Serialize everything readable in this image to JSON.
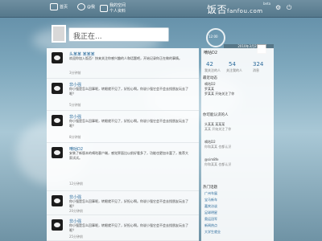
{
  "nav": {
    "home": "首页",
    "at": "@我",
    "my_space": "我的空间",
    "profile": "个人资料"
  },
  "logo": {
    "main": "饭否",
    "domain": "fanfou.com",
    "beta": "beta"
  },
  "composer": {
    "placeholder": "我正在..."
  },
  "clock": {
    "text": "12:00",
    "date": "2010年3月2日"
  },
  "sidebar": {
    "user_name": "嘀咕D2",
    "stats": [
      {
        "label": "我关注的人",
        "value": "42"
      },
      {
        "label": "关注我的人",
        "value": "54"
      },
      {
        "label": "消息",
        "value": "324"
      }
    ],
    "latest_label": "最近动态",
    "latest_items": [
      "嘀咕D2",
      "罗某某",
      "罗某某 开始关注了你"
    ],
    "who_to_follow_label": "你可能认识的人",
    "people": [
      {
        "name": "头某某 某某某",
        "note": "某某 开始关注了你"
      },
      {
        "name": "嘀咕D2",
        "note": "你和某某 也都认识"
      },
      {
        "name": "@sim8fe",
        "note": "你和某某 也都认识"
      }
    ],
    "hot_topics_label": "热门话题",
    "topics": [
      "广州车展",
      "宝马新车",
      "嘉宾访谈",
      "足球明星",
      "奥运冠军",
      "新闻热点",
      "大学生就业"
    ]
  },
  "timeline": [
    {
      "name": "头某某 某某某",
      "text": "欢迎你加入饭否！快来关注你感兴趣的人和话题吧，开始记录你正在做的事情。",
      "meta": "3分钟前"
    },
    {
      "name": "非小强",
      "text": "你小强是怎么回事呢，转眼就不见了，好担心啊。你说小强它会不会去找朋友玩去了呢？",
      "meta": "5分钟前"
    },
    {
      "name": "非小强",
      "text": "你小强是怎么回事呢，转眼就不见了，好担心啊。你说小强它会不会去找朋友玩去了呢？",
      "meta": "8分钟前"
    },
    {
      "name": "嘀咕D2",
      "text": "安装了新版本的嘀咕客户端，感觉界面比以前好看多了，功能也更加丰富了，推荐大家试试。",
      "meta": "12分钟前"
    },
    {
      "name": "非小强",
      "text": "你小强是怎么回事呢，转眼就不见了，好担心啊。你说小强它会不会去找朋友玩去了呢？",
      "meta": "20分钟前"
    },
    {
      "name": "非小强",
      "text": "你小强是怎么回事呢，转眼就不见了，好担心啊。你说小强它会不会去找朋友玩去了呢？",
      "meta": "25分钟前"
    }
  ]
}
